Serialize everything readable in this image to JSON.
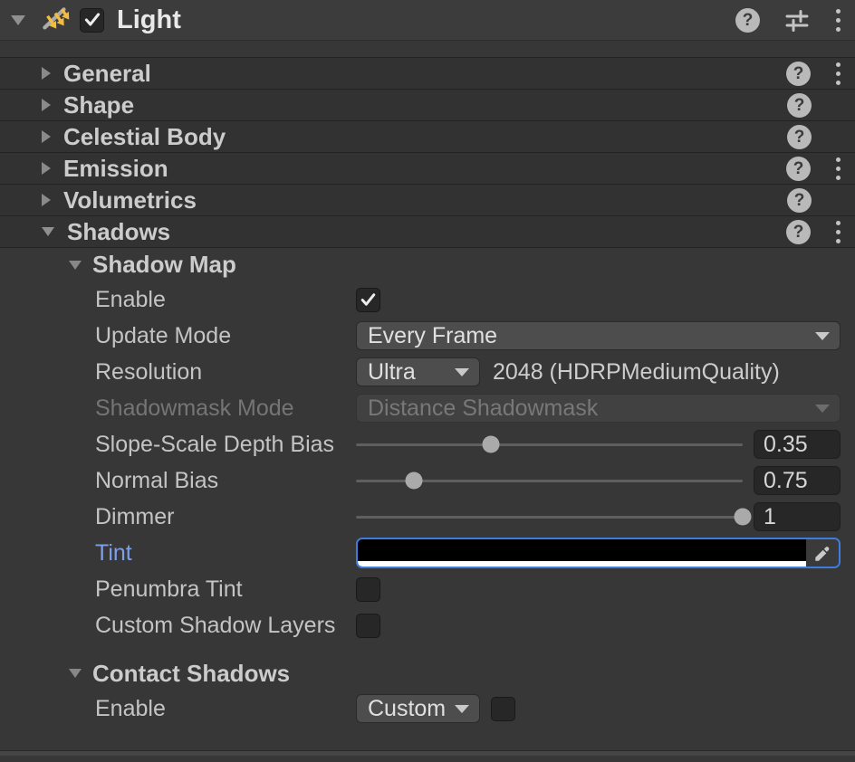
{
  "header": {
    "title": "Light",
    "enabled": true
  },
  "sections": [
    {
      "label": "General",
      "help": true,
      "menu": true,
      "expanded": false
    },
    {
      "label": "Shape",
      "help": true,
      "menu": false,
      "expanded": false
    },
    {
      "label": "Celestial Body",
      "help": true,
      "menu": false,
      "expanded": false
    },
    {
      "label": "Emission",
      "help": true,
      "menu": true,
      "expanded": false
    },
    {
      "label": "Volumetrics",
      "help": true,
      "menu": false,
      "expanded": false
    },
    {
      "label": "Shadows",
      "help": true,
      "menu": true,
      "expanded": true
    }
  ],
  "help_glyph": "?",
  "shadows": {
    "shadow_map": {
      "title": "Shadow Map",
      "enable": {
        "label": "Enable",
        "checked": true
      },
      "update_mode": {
        "label": "Update Mode",
        "value": "Every Frame"
      },
      "resolution": {
        "label": "Resolution",
        "value": "Ultra",
        "info": "2048 (HDRPMediumQuality)"
      },
      "shadowmask_mode": {
        "label": "Shadowmask Mode",
        "value": "Distance Shadowmask",
        "disabled": true
      },
      "sliders": {
        "slope_bias": {
          "label": "Slope-Scale Depth Bias",
          "value": 0.35,
          "display": "0.35",
          "min": 0,
          "max": 1
        },
        "normal_bias": {
          "label": "Normal Bias",
          "value": 0.75,
          "display": "0.75",
          "min": 0,
          "max": 5
        },
        "dimmer": {
          "label": "Dimmer",
          "value": 1,
          "display": "1",
          "min": 0,
          "max": 1
        }
      },
      "tint": {
        "label": "Tint",
        "value_hex": "#000000",
        "alpha": 1,
        "focused": true
      },
      "penumbra_tint": {
        "label": "Penumbra Tint",
        "checked": false
      },
      "custom_shadow_layers": {
        "label": "Custom Shadow Layers",
        "checked": false
      }
    },
    "contact_shadows": {
      "title": "Contact Shadows",
      "enable": {
        "label": "Enable",
        "value": "Custom",
        "checked": false
      }
    }
  },
  "colors": {
    "focus_blue": "#3E7DDD",
    "override_label_blue": "#7E9FEA",
    "light_icon_yellow": "#F2BC40",
    "tint_swatch": "#000000",
    "tint_alpha_bar": "#FFFFFF"
  }
}
